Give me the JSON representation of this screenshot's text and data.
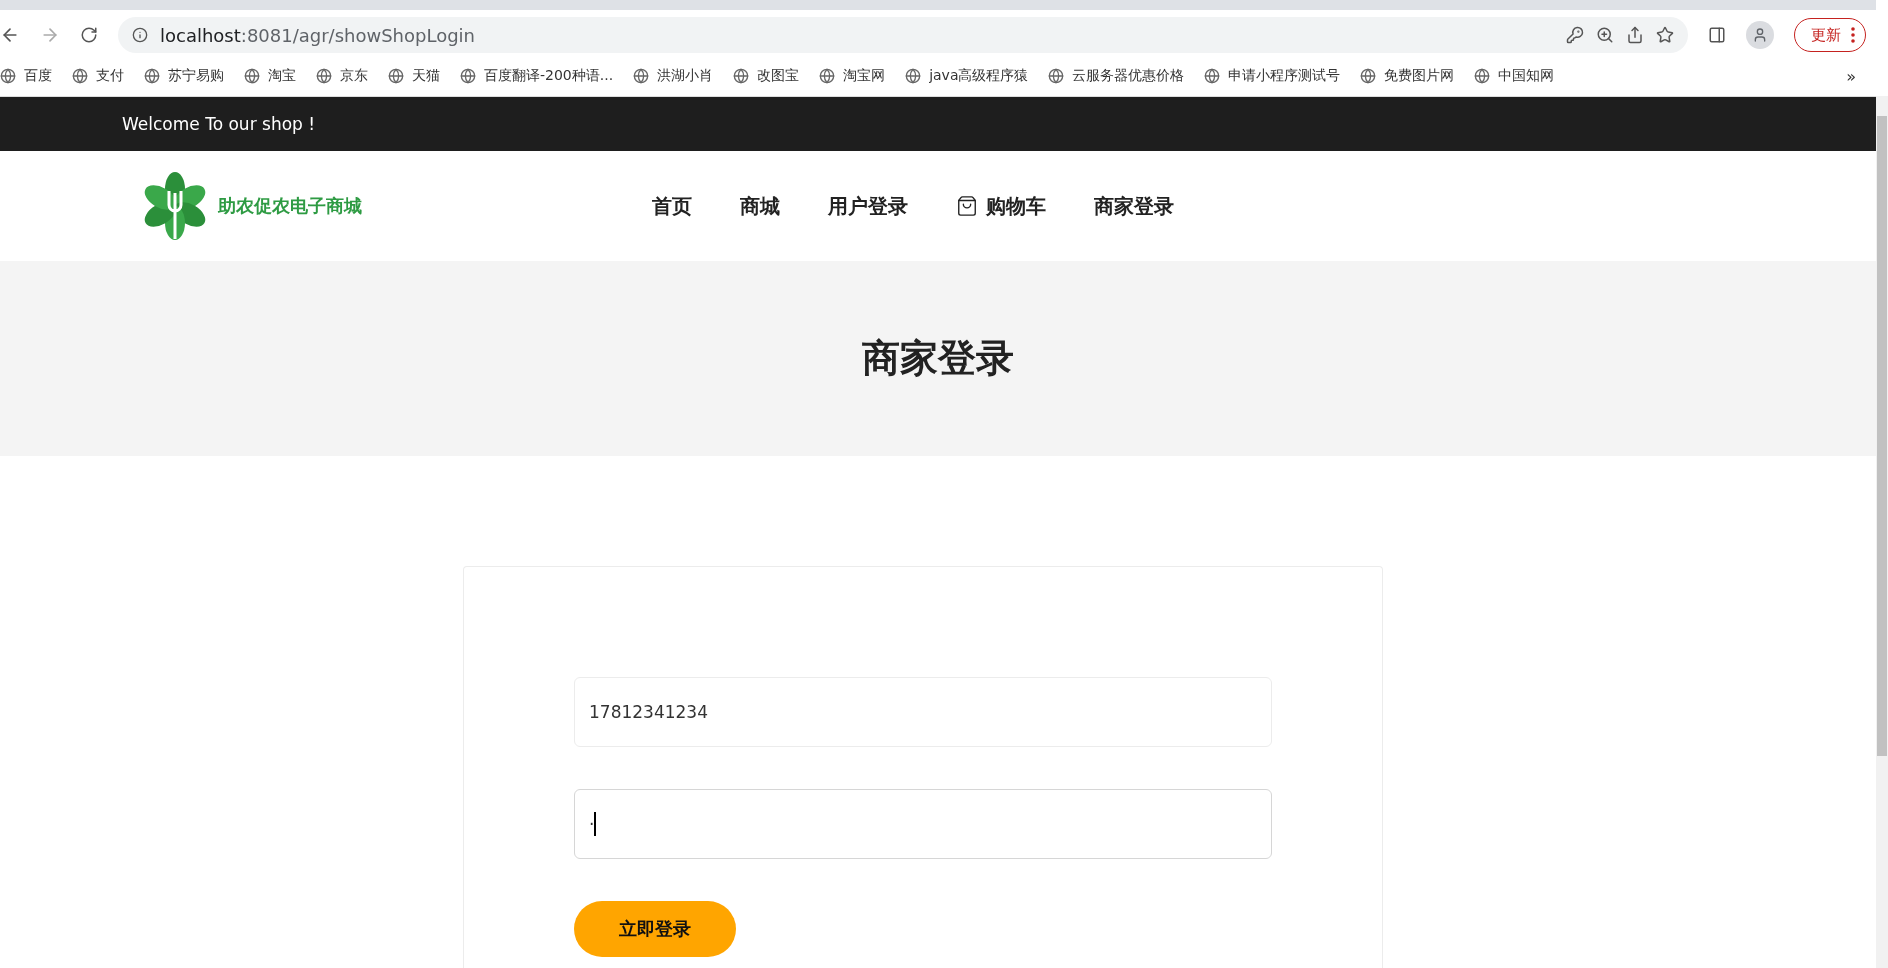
{
  "browser": {
    "url_host": "localhost",
    "url_path": ":8081/agr/showShopLogin",
    "update_button": "更新"
  },
  "bookmarks": [
    {
      "label": "百度"
    },
    {
      "label": "支付"
    },
    {
      "label": "苏宁易购"
    },
    {
      "label": "淘宝"
    },
    {
      "label": "京东"
    },
    {
      "label": "天猫"
    },
    {
      "label": "百度翻译-200种语..."
    },
    {
      "label": "洪湖小肖"
    },
    {
      "label": "改图宝"
    },
    {
      "label": "淘宝网"
    },
    {
      "label": "java高级程序猿"
    },
    {
      "label": "云服务器优惠价格"
    },
    {
      "label": "申请小程序测试号"
    },
    {
      "label": "免费图片网"
    },
    {
      "label": "中国知网"
    }
  ],
  "bookmarks_more": "»",
  "top_bar": {
    "welcome": "Welcome To our shop !"
  },
  "header": {
    "logo_text": "助农促农电子商城",
    "nav": [
      {
        "label": "首页",
        "kind": "text"
      },
      {
        "label": "商城",
        "kind": "text"
      },
      {
        "label": "用户登录",
        "kind": "text"
      },
      {
        "label": "购物车",
        "kind": "cart"
      },
      {
        "label": "商家登录",
        "kind": "text"
      }
    ]
  },
  "hero": {
    "title": "商家登录"
  },
  "form": {
    "fields": [
      {
        "value": "17812341234",
        "focused": false
      },
      {
        "value": "·",
        "focused": true
      }
    ],
    "submit": "立即登录"
  }
}
